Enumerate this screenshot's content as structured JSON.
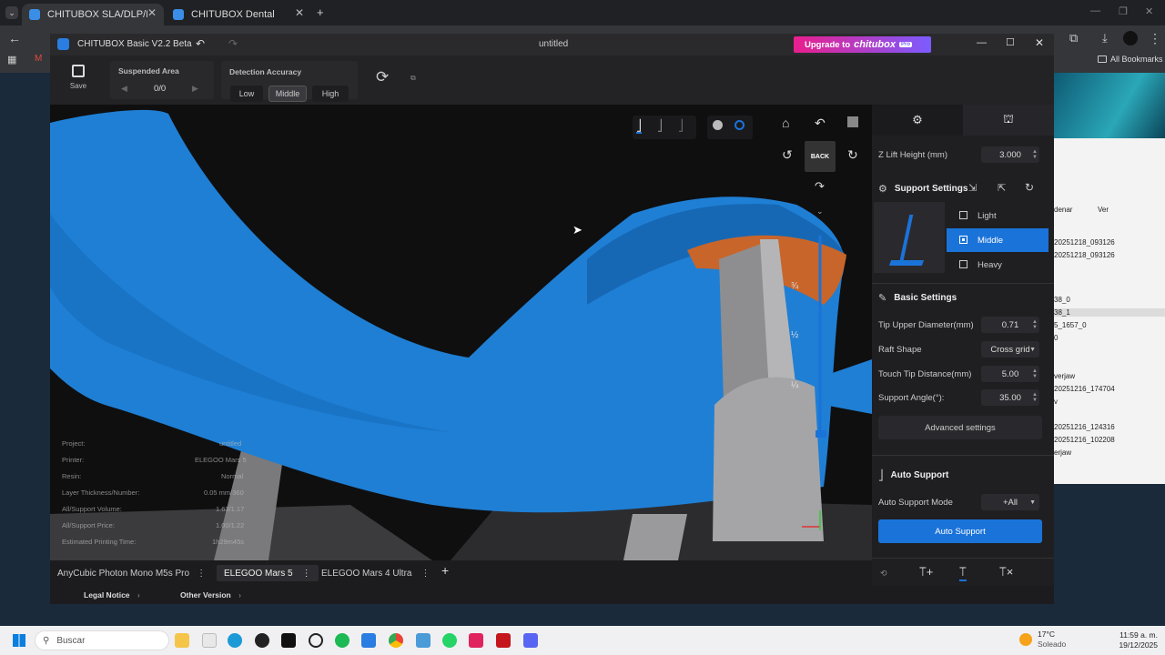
{
  "browser": {
    "tabs": [
      {
        "title": "CHITUBOX SLA/DLP/LCD 3D Sli",
        "active": true
      },
      {
        "title": "CHITUBOX Dental",
        "active": false
      }
    ],
    "new_tab": "+",
    "bookmarks_label": "All Bookmarks",
    "background_list": {
      "toolbar_left": "denar",
      "toolbar_right": "Ver",
      "rows": [
        "20251218_093126",
        "20251218_093126",
        "38_0",
        "38_1",
        "5_1657_0",
        "0",
        "verjaw",
        "20251216_174704",
        "v",
        "20251216_124316",
        "20251216_102208",
        "erjaw"
      ]
    }
  },
  "app": {
    "title": "CHITUBOX Basic V2.2 Beta",
    "document": "untitled",
    "upgrade_label": "Upgrade to",
    "upgrade_brand": "chitubox",
    "upgrade_badge": "Pro",
    "toolbar": {
      "save_label": "Save",
      "suspended_area_label": "Suspended Area",
      "suspended_area_value": "0/0",
      "detection_label": "Detection Accuracy",
      "detection_options": [
        "Low",
        "Middle",
        "High"
      ],
      "detection_selected": "Middle"
    },
    "viewport": {
      "back_label": "BACK",
      "ruler_marks": [
        "¾",
        "½",
        "¼"
      ],
      "info": [
        {
          "label": "Project:",
          "value": "untitled"
        },
        {
          "label": "Printer:",
          "value": "ELEGOO Mars 5"
        },
        {
          "label": "Resin:",
          "value": "Normal"
        },
        {
          "label": "Layer Thickness/Number:",
          "value": "0.05 mm/360"
        },
        {
          "label": "All/Support Volume:",
          "value": "1.63/1.17"
        },
        {
          "label": "All/Support Price:",
          "value": "1.00/1.22"
        },
        {
          "label": "Estimated Printing Time:",
          "value": "1h29m45s"
        }
      ]
    },
    "printers": [
      "AnyCubic Photon Mono M5s Pro",
      "ELEGOO Mars 5",
      "ELEGOO Mars 4 Ultra"
    ],
    "printer_selected": "ELEGOO Mars 5",
    "footer": {
      "legal": "Legal Notice",
      "other": "Other Version"
    },
    "panel": {
      "z_lift_label": "Z Lift Height (mm)",
      "z_lift_value": "3.000",
      "support_settings_title": "Support Settings",
      "presets": [
        "Light",
        "Middle",
        "Heavy"
      ],
      "preset_selected": "Middle",
      "basic_settings_title": "Basic Settings",
      "tip_upper_label": "Tip Upper Diameter(mm)",
      "tip_upper_value": "0.71",
      "raft_shape_label": "Raft Shape",
      "raft_shape_value": "Cross grid",
      "touch_tip_label": "Touch Tip Distance(mm)",
      "touch_tip_value": "5.00",
      "support_angle_label": "Support Angle(°):",
      "support_angle_value": "35.00",
      "advanced_label": "Advanced settings",
      "auto_support_title": "Auto Support",
      "auto_mode_label": "Auto Support Mode",
      "auto_mode_value": "+All",
      "auto_button": "Auto Support"
    },
    "colors": {
      "accent": "#1a73d9",
      "upgrade": "#e91e8c",
      "model": "#1f7fd4",
      "support": "#8e8e90",
      "orange": "#c8652a"
    }
  },
  "taskbar": {
    "search_placeholder": "Buscar",
    "weather_temp": "17°C",
    "weather_desc": "Soleado",
    "time": "11:59 a. m.",
    "date": "19/12/2025"
  }
}
